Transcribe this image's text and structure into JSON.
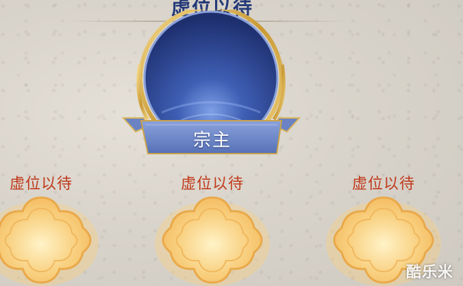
{
  "title": "虚位以待",
  "leader_slot": {
    "label": "宗主",
    "colors": {
      "disc": "#2e4a9a",
      "banner": "#6f88c8",
      "frame": "#d4a93e"
    }
  },
  "member_slots": [
    {
      "label": "虚位以待"
    },
    {
      "label": "虚位以待"
    },
    {
      "label": "虚位以待"
    }
  ],
  "colors": {
    "title": "#243a78",
    "slot_label": "#c0391b",
    "slot_emblem": "#f6c877"
  },
  "watermark": "酷乐米"
}
